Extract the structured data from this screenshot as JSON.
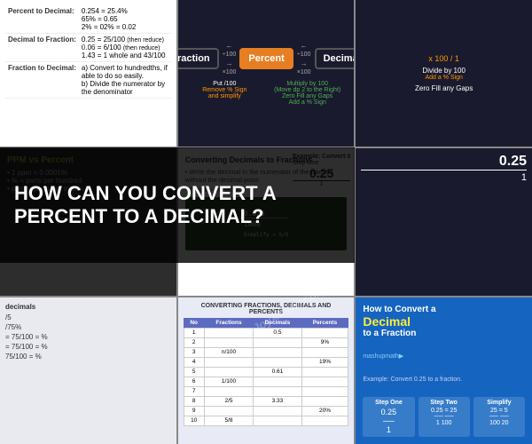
{
  "watermarks": [
    "JoyAnswer.org",
    "JoyAnswer.org"
  ],
  "cell1": {
    "rows": [
      {
        "label": "Percent to Decimal:",
        "value": "0.254 = 25.4%\n65% = 0.65\n2% = 02% = 0.02"
      },
      {
        "label": "Decimal to Fraction:",
        "value": "0.25 = 25/100 (then reduce)\n0.06 = 6/100 (then reduce)\n1.43 = 1 whole and 43/100"
      },
      {
        "label": "Fraction to Decimal:",
        "value": "a) Convert to hundredths, if able to do so easily.\nb) Divide the numerator by the denominator"
      }
    ]
  },
  "cell2": {
    "fraction_label": "Fraction",
    "percent_label": "Percent",
    "decimal_label": "Decimal",
    "left_instructions": [
      "Put /100",
      "Remove % Sign",
      "and simplify"
    ],
    "right_instructions": [
      "Multiply by 100",
      "(Move dp 2 to the Right)",
      "Zero Fill any Gaps",
      "Add a % Sign"
    ],
    "left_arrow_label": "÷100",
    "right_arrow_label": "×100"
  },
  "cell4": {
    "title": "PPM vs Percent",
    "subtitle": "• 1 ppm = 0.0001%\n• % = parts per hundred\n• ppm = parts per million"
  },
  "cell5": {
    "title": "Converting Decimals to Fractions",
    "steps": [
      "• Write the decimal in the numerator of the fraction without the decimal point.",
      "• Simplify or Reduce"
    ],
    "example": "Example: Convert 0",
    "step_one": "Step One"
  },
  "cell8": {
    "title": "Converting Fractions, Decimals and Percents",
    "headers": [
      "No",
      "Fractions",
      "Decimals",
      "Percents"
    ],
    "rows": [
      [
        "1",
        "",
        "0.5",
        ""
      ],
      [
        "2",
        "",
        "",
        "9%"
      ],
      [
        "3",
        "n/100",
        "",
        ""
      ],
      [
        "4",
        "",
        "",
        "19%"
      ],
      [
        "5",
        "",
        "0.61",
        ""
      ],
      [
        "6",
        "1/100",
        "",
        ""
      ],
      [
        "7",
        "",
        "",
        ""
      ],
      [
        "8",
        "2/5",
        "3.33",
        ""
      ],
      [
        "9",
        "",
        "",
        "20%"
      ],
      [
        "10",
        "5/8",
        "",
        ""
      ]
    ]
  },
  "cell9": {
    "title_line1": "How to Convert a",
    "title_line2": "Decimal",
    "title_line3": "to a  Fraction",
    "brand": "mashupmath▶",
    "example_label": "Example: Convert 0.25 to a fraction.",
    "steps": [
      {
        "label": "Step One",
        "value": "0.25\n──\n1"
      },
      {
        "label": "Step Two",
        "value": "0.25   =   25\n──       ──\n1          100"
      },
      {
        "label": "Simplify",
        "value": "25   =   5\n──       ──\n100     20"
      }
    ]
  },
  "overlay": {
    "text": "HOW CAN YOU CONVERT A PERCENT TO A DECIMAL?"
  },
  "decimal_list": {
    "title": "decimals",
    "items": [
      "/5",
      "/75%",
      "= 75/100 = %",
      "= 75/100 = %",
      "75/100 = %"
    ]
  }
}
